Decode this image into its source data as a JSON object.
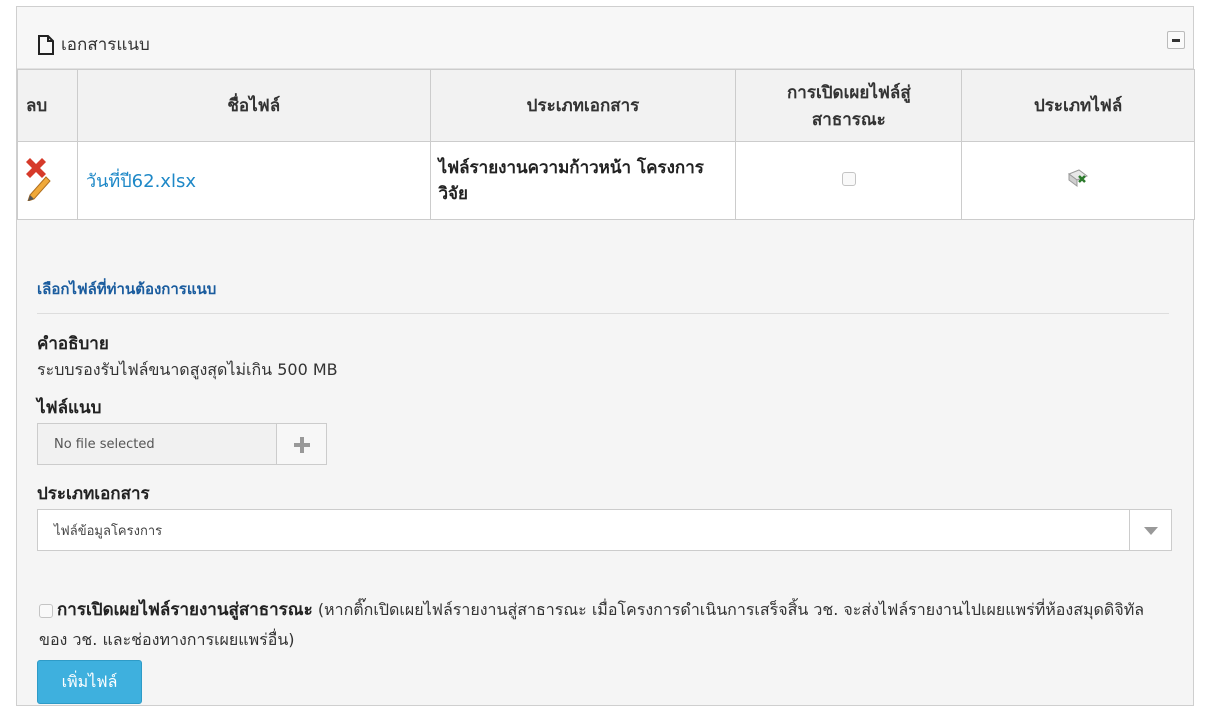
{
  "panel": {
    "title": "เอกสารแนบ"
  },
  "table": {
    "headers": [
      "ลบ",
      "ชื่อไฟล์",
      "ประเภทเอกสาร",
      "การเปิดเผยไฟล์สู่สาธารณะ",
      "ประเภทไฟล์"
    ],
    "rows": [
      {
        "file_name": "วันที่ปี62.xlsx",
        "doc_type": "ไฟล์รายงานความก้าวหน้า โครงการวิจัย"
      }
    ]
  },
  "form": {
    "section_title": "เลือกไฟล์ที่ท่านต้องการแนบ",
    "description_label": "คำอธิบาย",
    "description_text": "ระบบรองรับไฟล์ขนาดสูงสุดไม่เกิน 500 MB",
    "attach_label": "ไฟล์แนบ",
    "file_placeholder": "No file selected",
    "doc_type_label": "ประเภทเอกสาร",
    "doc_type_selected": "ไฟล์ข้อมูลโครงการ",
    "disclose_label": "การเปิดเผยไฟล์รายงานสู่สาธารณะ",
    "disclose_note": "(หากติ๊กเปิดเผยไฟล์รายงานสู่สาธารณะ เมื่อโครงการดำเนินการเสร็จสิ้น วช. จะส่งไฟล์รายงานไปเผยแพร่ที่ห้องสมุดดิจิทัลของ วช. และช่องทางการเผยแพร่อื่น)",
    "add_button": "เพิ่มไฟล์"
  },
  "colors": {
    "link": "#1e88c7",
    "button": "#3eb0de",
    "section_title": "#1a5c9e"
  }
}
